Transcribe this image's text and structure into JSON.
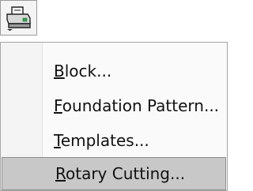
{
  "toolbar": {
    "button_icon": "printer-icon",
    "dropdown_icon": "triangle-down-icon"
  },
  "menu": {
    "items": [
      {
        "label": "Block..."
      },
      {
        "label": "Foundation Pattern..."
      },
      {
        "label": "Templates..."
      },
      {
        "label": "Rotary Cutting..."
      }
    ],
    "highlighted_item": "Rotary Cutting..."
  }
}
